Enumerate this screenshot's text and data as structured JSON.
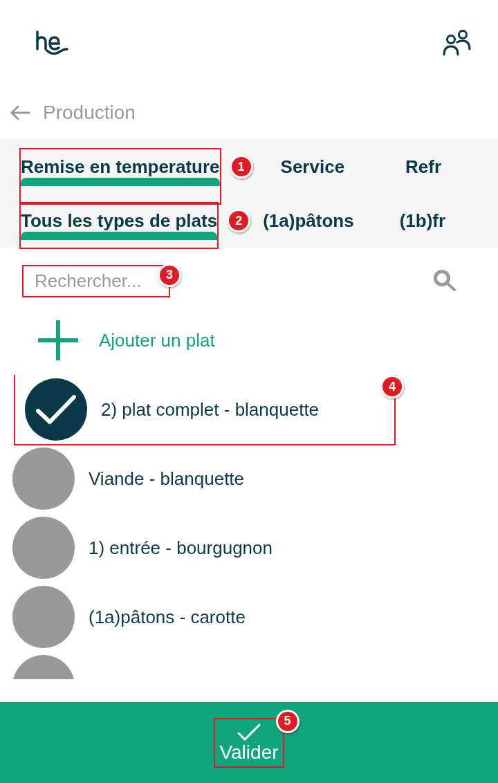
{
  "header": {
    "back_label": "Production"
  },
  "tabs": [
    {
      "label": "Remise en temperature",
      "selected": true,
      "annotation": "1"
    },
    {
      "label": "Service",
      "selected": false
    },
    {
      "label": "Refr",
      "selected": false
    }
  ],
  "subtabs": [
    {
      "label": "Tous les types de plats",
      "selected": true,
      "annotation": "2"
    },
    {
      "label": "(1a)pâtons",
      "selected": false
    },
    {
      "label": "(1b)fr",
      "selected": false
    }
  ],
  "search": {
    "placeholder": "Rechercher...",
    "annotation": "3"
  },
  "add_button": {
    "label": "Ajouter un plat"
  },
  "dishes": [
    {
      "label": "2) plat complet - blanquette",
      "checked": true,
      "annotation": "4"
    },
    {
      "label": "Viande - blanquette",
      "checked": false
    },
    {
      "label": "1) entrée - bourgugnon",
      "checked": false
    },
    {
      "label": "(1a)pâtons - carotte",
      "checked": false
    },
    {
      "checked": false
    }
  ],
  "footer": {
    "button_label": "Valider",
    "annotation": "5"
  }
}
